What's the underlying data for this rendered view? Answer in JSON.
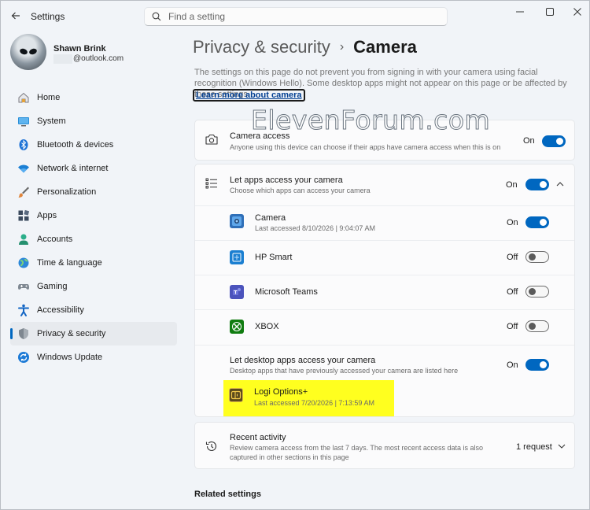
{
  "window": {
    "app_title": "Settings",
    "search_placeholder": "Find a setting"
  },
  "profile": {
    "name": "Shawn Brink",
    "email": "@outlook.com"
  },
  "nav": [
    {
      "label": "Home",
      "icon": "home-icon"
    },
    {
      "label": "System",
      "icon": "system-icon"
    },
    {
      "label": "Bluetooth & devices",
      "icon": "bluetooth-icon"
    },
    {
      "label": "Network & internet",
      "icon": "wifi-icon"
    },
    {
      "label": "Personalization",
      "icon": "brush-icon"
    },
    {
      "label": "Apps",
      "icon": "apps-icon"
    },
    {
      "label": "Accounts",
      "icon": "accounts-icon"
    },
    {
      "label": "Time & language",
      "icon": "globe-icon"
    },
    {
      "label": "Gaming",
      "icon": "gamepad-icon"
    },
    {
      "label": "Accessibility",
      "icon": "accessibility-icon"
    },
    {
      "label": "Privacy & security",
      "icon": "shield-icon"
    },
    {
      "label": "Windows Update",
      "icon": "update-icon"
    }
  ],
  "breadcrumb": {
    "parent": "Privacy & security",
    "separator": "›",
    "current": "Camera"
  },
  "description": "The settings on this page do not prevent you from signing in with your camera using facial recognition (Windows Hello). Some desktop apps might not appear on this page or be affected by these settings.",
  "learn_more": "Learn more about camera",
  "watermark": "ElevenForum.com",
  "camera_access": {
    "title": "Camera access",
    "subtitle": "Anyone using this device can choose if their apps have camera access when this is on",
    "state": "On"
  },
  "let_apps": {
    "title": "Let apps access your camera",
    "subtitle": "Choose which apps can access your camera",
    "state": "On"
  },
  "apps": [
    {
      "name": "Camera",
      "detail": "Last accessed 8/10/2026  |  9:04:07 AM",
      "state": "On",
      "on": true
    },
    {
      "name": "HP Smart",
      "detail": "",
      "state": "Off",
      "on": false
    },
    {
      "name": "Microsoft Teams",
      "detail": "",
      "state": "Off",
      "on": false
    },
    {
      "name": "XBOX",
      "detail": "",
      "state": "Off",
      "on": false
    }
  ],
  "desktop_apps": {
    "title": "Let desktop apps access your camera",
    "subtitle": "Desktop apps that have previously accessed your camera are listed here",
    "state": "On",
    "app_name": "Logi Options+",
    "app_detail": "Last accessed 7/20/2026  |  7:13:59 AM"
  },
  "recent_activity": {
    "title": "Recent activity",
    "subtitle_line1": "Review camera access from the last 7 days. The most recent access data is also",
    "subtitle_line2": "captured in other sections in this page",
    "count": "1 request"
  },
  "related_settings": "Related settings",
  "colors": {
    "accent": "#0067c0",
    "highlight": "#ffff1f"
  }
}
